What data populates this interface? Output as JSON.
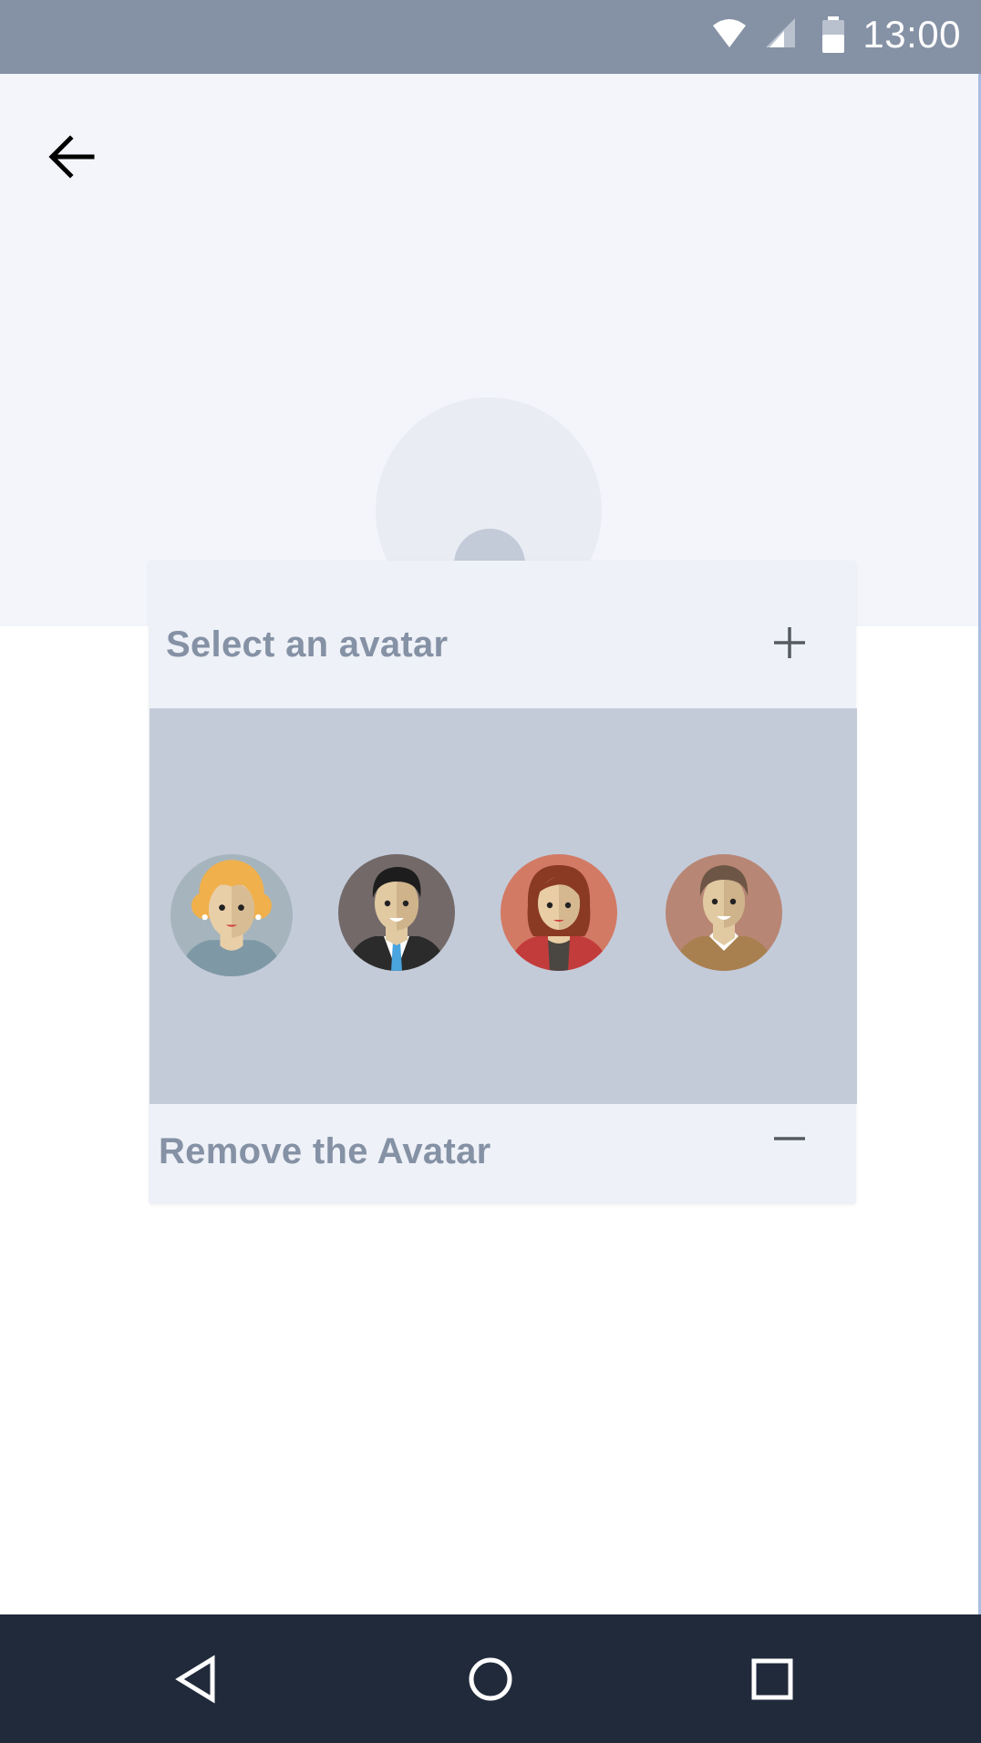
{
  "status_bar": {
    "time": "13:00",
    "icons": [
      "wifi-icon",
      "cell-signal-icon",
      "battery-icon"
    ]
  },
  "header": {
    "back_icon": "arrow-left-icon",
    "profile_placeholder_icon": "user-placeholder-icon"
  },
  "dialog": {
    "select_label": "Select an avatar",
    "select_icon": "plus-icon",
    "avatars": [
      {
        "name": "avatar-blonde-woman"
      },
      {
        "name": "avatar-man-in-suit"
      },
      {
        "name": "avatar-redhead-woman"
      },
      {
        "name": "avatar-man-brown-jacket"
      }
    ],
    "remove_label": "Remove the Avatar",
    "remove_icon": "minus-icon"
  },
  "nav_bar": {
    "items": [
      "nav-back-icon",
      "nav-home-icon",
      "nav-recents-icon"
    ]
  },
  "colors": {
    "status_bar": "#8591a5",
    "header_bg": "#f3f5fb",
    "dialog_bg": "#eef1f7",
    "avatar_panel_bg": "#c3cbd9",
    "label_text": "#8591a5",
    "nav_bar": "#212a3b"
  }
}
